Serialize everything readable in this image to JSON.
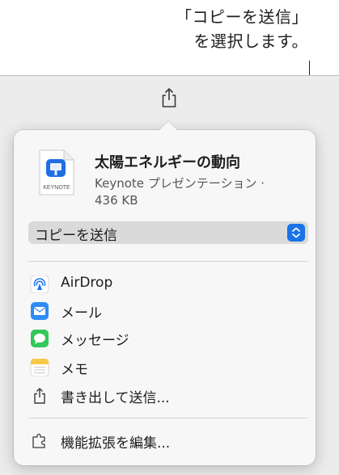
{
  "callout": {
    "line1": "「コピーを送信」",
    "line2": "を選択します。"
  },
  "document": {
    "title": "太陽エネルギーの動向",
    "kind": "Keynote プレゼンテーション ·",
    "size": "436 KB",
    "icon_label": "KEYNOTE"
  },
  "share_mode": {
    "selected": "コピーを送信"
  },
  "menu": [
    {
      "label": "AirDrop",
      "icon": "airdrop-icon"
    },
    {
      "label": "メール",
      "icon": "mail-icon"
    },
    {
      "label": "メッセージ",
      "icon": "messages-icon"
    },
    {
      "label": "メモ",
      "icon": "notes-icon"
    },
    {
      "label": "書き出して送信...",
      "icon": "share-export-icon"
    }
  ],
  "extensions": {
    "label": "機能拡張を編集...",
    "icon": "extensions-icon"
  },
  "colors": {
    "accent": "#1a73e8",
    "popover_bg": "#f7f7f7",
    "window_bg": "#ececec"
  }
}
